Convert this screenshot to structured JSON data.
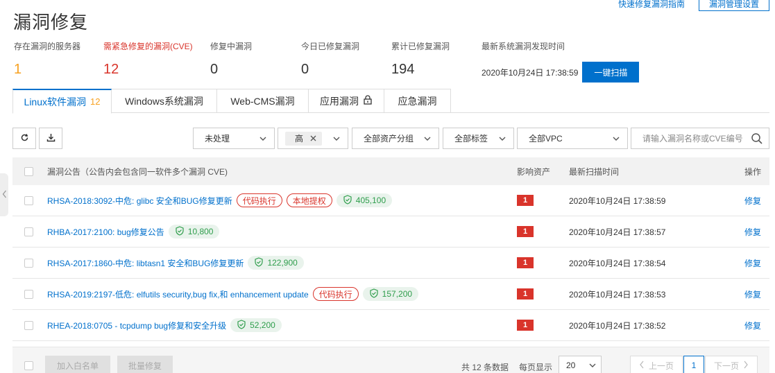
{
  "top": {
    "link_label": "快速修复漏洞指南",
    "settings_button": "漏洞管理设置"
  },
  "page_title": "漏洞修复",
  "stats": {
    "servers": {
      "label": "存在漏洞的服务器",
      "value": "1"
    },
    "urgent": {
      "label": "需紧急修复的漏洞(CVE)",
      "value": "12"
    },
    "fixing": {
      "label": "修复中漏洞",
      "value": "0"
    },
    "today_fixed": {
      "label": "今日已修复漏洞",
      "value": "0"
    },
    "total_fixed": {
      "label": "累计已修复漏洞",
      "value": "194"
    },
    "latest": {
      "label": "最新系统漏洞发现时间",
      "time": "2020年10月24日 17:38:59",
      "scan_button": "一键扫描"
    }
  },
  "tabs": [
    {
      "label": "Linux软件漏洞",
      "count": "12"
    },
    {
      "label": "Windows系统漏洞"
    },
    {
      "label": "Web-CMS漏洞"
    },
    {
      "label": "应用漏洞"
    },
    {
      "label": "应急漏洞"
    }
  ],
  "filters": {
    "status": "未处理",
    "level_tag": "高",
    "asset_group": "全部资产分组",
    "tags": "全部标签",
    "vpc": "全部VPC",
    "search_placeholder": "请输入漏洞名称或CVE编号"
  },
  "table": {
    "headers": {
      "title": "漏洞公告（公告内会包含同一软件多个漏洞 CVE)",
      "asset": "影响资产",
      "time": "最新扫描时间",
      "op": "操作"
    },
    "rows": [
      {
        "title": "RHSA-2018:3092-中危: glibc 安全和BUG修复更新",
        "badges": [
          "代码执行",
          "本地提权"
        ],
        "score": "405,100",
        "asset": "1",
        "time": "2020年10月24日 17:38:59",
        "op": "修复"
      },
      {
        "title": "RHBA-2017:2100: bug修复公告",
        "badges": [],
        "score": "10,800",
        "asset": "1",
        "time": "2020年10月24日 17:38:57",
        "op": "修复"
      },
      {
        "title": "RHSA-2017:1860-中危: libtasn1 安全和BUG修复更新",
        "badges": [],
        "score": "122,900",
        "asset": "1",
        "time": "2020年10月24日 17:38:54",
        "op": "修复"
      },
      {
        "title": "RHSA-2019:2197-低危: elfutils security,bug fix,和 enhancement update",
        "badges": [
          "代码执行"
        ],
        "score": "157,200",
        "asset": "1",
        "time": "2020年10月24日 17:38:53",
        "op": "修复"
      },
      {
        "title": "RHEA-2018:0705 - tcpdump bug修复和安全升级",
        "badges": [],
        "score": "52,200",
        "asset": "1",
        "time": "2020年10月24日 17:38:52",
        "op": "修复"
      }
    ]
  },
  "footer": {
    "whitelist_button": "加入白名单",
    "batch_fix_button": "批量修复",
    "total_text": "共 12 条数据",
    "per_page_label": "每页显示",
    "per_page_value": "20",
    "prev": "上一页",
    "page": "1",
    "next": "下一页"
  },
  "colors": {
    "primary": "#0070cc",
    "danger": "#d9342b",
    "warning": "#f7a120",
    "success": "#2e9d4b"
  }
}
